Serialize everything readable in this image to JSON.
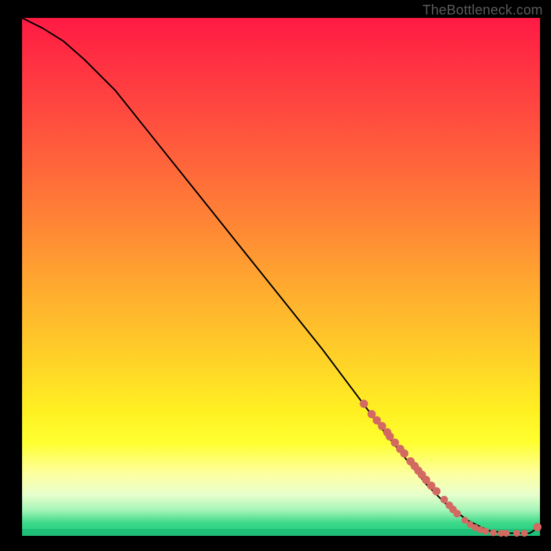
{
  "watermark": "TheBottleneck.com",
  "chart_data": {
    "type": "line",
    "title": "",
    "xlabel": "",
    "ylabel": "",
    "xlim": [
      0,
      100
    ],
    "ylim": [
      0,
      100
    ],
    "grid": false,
    "legend": false,
    "series": [
      {
        "name": "curve",
        "color": "#000000",
        "x": [
          0,
          4,
          8,
          12,
          18,
          26,
          34,
          42,
          50,
          58,
          64,
          70,
          74,
          78,
          82,
          86,
          90,
          94,
          98,
          100
        ],
        "y": [
          100,
          98,
          95.5,
          92,
          86,
          76,
          66,
          56,
          46,
          36,
          28,
          20,
          15,
          10,
          6,
          3,
          1,
          0.5,
          0.5,
          1.8
        ]
      },
      {
        "name": "markers",
        "color": "#d26a62",
        "type": "scatter",
        "x": [
          66,
          67.5,
          68.5,
          69.5,
          70.5,
          71,
          72,
          73,
          73.8,
          75,
          75.8,
          76.5,
          77.2,
          78,
          79,
          80,
          81.5,
          82.5,
          83.2,
          84,
          85.5,
          86.5,
          87.5,
          88.5,
          89.5,
          91,
          92.5,
          93.5,
          95.5,
          97,
          99.5
        ],
        "y": [
          25.5,
          23.5,
          22.3,
          21.2,
          20,
          19.2,
          18,
          16.8,
          15.9,
          14.4,
          13.5,
          12.6,
          11.8,
          10.8,
          9.7,
          8.6,
          7,
          5.9,
          5.1,
          4.3,
          3,
          2.2,
          1.6,
          1.2,
          0.9,
          0.6,
          0.5,
          0.5,
          0.5,
          0.5,
          1.7
        ],
        "r": [
          6,
          6,
          6,
          6,
          6,
          6,
          6,
          6,
          6,
          6,
          6,
          6,
          6,
          6,
          6,
          6,
          5.5,
          5.5,
          5.5,
          5.5,
          5,
          5,
          5,
          5,
          5,
          5,
          5,
          5,
          5,
          5,
          6
        ]
      }
    ],
    "background_gradient": {
      "top": "#ff1a44",
      "mid": "#ffe828",
      "bottom": "#1fc97e"
    }
  }
}
